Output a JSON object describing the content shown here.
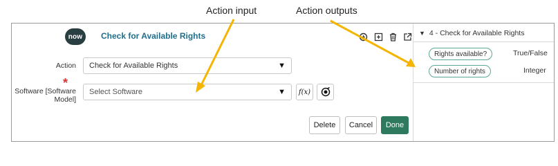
{
  "annotations": {
    "action_input_label": "Action input",
    "action_outputs_label": "Action outputs",
    "arrow_color": "#f4b400"
  },
  "header": {
    "logo_text": "now",
    "title": "Check for Available Rights",
    "tools": [
      "copy-icon",
      "add-icon",
      "trash-icon",
      "open-external-icon"
    ]
  },
  "form": {
    "action_label": "Action",
    "action_value": "Check for Available Rights",
    "software_label_line1": "Software [Software",
    "software_label_line2": "Model]",
    "required_marker": "*",
    "software_placeholder": "Select Software",
    "fx_label": "f(x)"
  },
  "footer": {
    "delete_label": "Delete",
    "cancel_label": "Cancel",
    "done_label": "Done"
  },
  "outputs_panel": {
    "header": "4 - Check for Available Rights",
    "items": [
      {
        "name": "Rights available?",
        "type": "True/False"
      },
      {
        "name": "Number of rights",
        "type": "Integer"
      }
    ]
  },
  "colors": {
    "accent": "#2e7a5e",
    "title": "#1f6e8c",
    "pill_border": "#5ba896",
    "required": "#dd3333"
  }
}
